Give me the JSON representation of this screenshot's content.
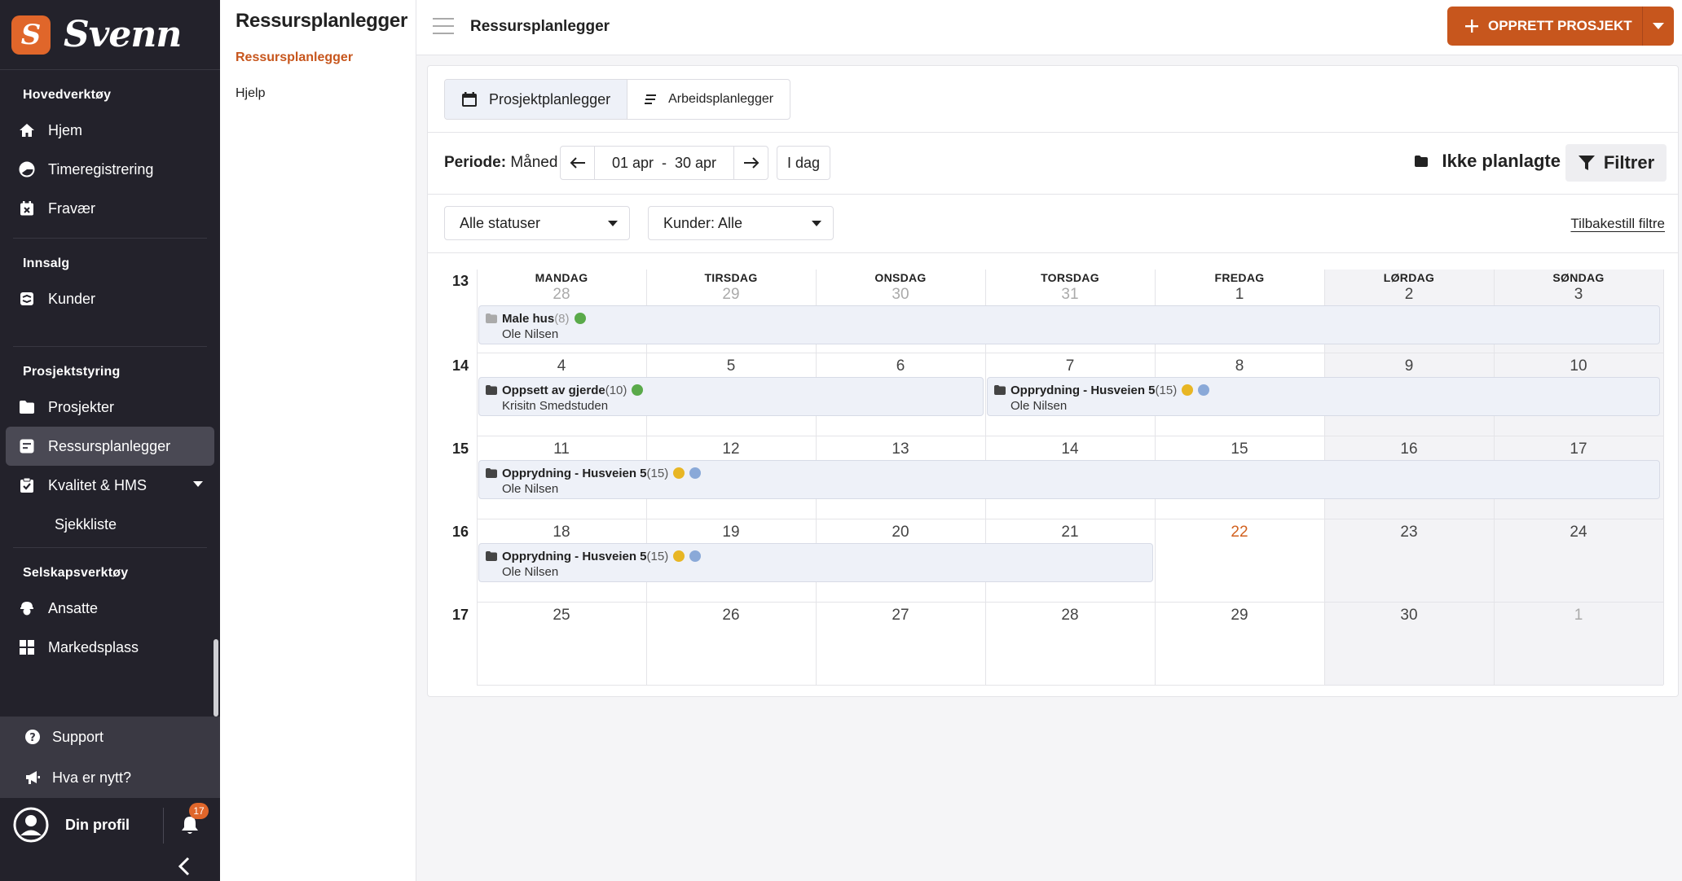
{
  "logo": {
    "badge": "S",
    "name": "Svenn"
  },
  "sidebar": {
    "sections": [
      {
        "heading": "Hovedverktøy",
        "items": [
          {
            "label": "Hjem",
            "icon": "home-icon"
          },
          {
            "label": "Timeregistrering",
            "icon": "clock-icon"
          },
          {
            "label": "Fravær",
            "icon": "calendar-x-icon"
          }
        ]
      },
      {
        "heading": "Innsalg",
        "items": [
          {
            "label": "Kunder",
            "icon": "customers-icon"
          }
        ]
      },
      {
        "heading": "Prosjektstyring",
        "items": [
          {
            "label": "Prosjekter",
            "icon": "folder-icon"
          },
          {
            "label": "Ressursplanlegger",
            "icon": "planner-icon",
            "active": true
          },
          {
            "label": "Kvalitet & HMS",
            "icon": "quality-icon",
            "expandable": true
          },
          {
            "label": "Sjekkliste",
            "sub": true
          }
        ]
      },
      {
        "heading": "Selskapsverktøy",
        "items": [
          {
            "label": "Ansatte",
            "icon": "employees-icon"
          },
          {
            "label": "Markedsplass",
            "icon": "marketplace-icon"
          }
        ]
      }
    ],
    "bottom": {
      "support": "Support",
      "news": "Hva er nytt?",
      "profile": "Din profil",
      "notifications": "17"
    }
  },
  "subpanel": {
    "title": "Ressursplanlegger",
    "links": [
      "Ressursplanlegger",
      "Hjelp"
    ]
  },
  "topbar": {
    "title": "Ressursplanlegger",
    "create_button": "OPPRETT PROSJEKT"
  },
  "tabs": [
    {
      "label": "Prosjektplanlegger",
      "active": true
    },
    {
      "label": "Arbeidsplanlegger",
      "active": false
    }
  ],
  "period": {
    "label": "Periode:",
    "value": "Måned",
    "range_start": "01 apr",
    "range_sep": "-",
    "range_end": "30 apr",
    "today": "I dag",
    "unplanned": "Ikke planlagte",
    "filter": "Filtrer"
  },
  "filters": {
    "status": "Alle statuser",
    "customers": "Kunder: Alle",
    "reset": "Tilbakestill filtre"
  },
  "colors": {
    "brand": "#c7561d",
    "green": "#5aaa4a",
    "yellow": "#e8b624",
    "blue": "#8aa9d8",
    "today": "#d2611f"
  },
  "calendar": {
    "weekdays": [
      "MANDAG",
      "TIRSDAG",
      "ONSDAG",
      "TORSDAG",
      "FREDAG",
      "LØRDAG",
      "SØNDAG"
    ],
    "weeks": [
      {
        "num": "13",
        "days": [
          {
            "d": "28",
            "muted": true
          },
          {
            "d": "29",
            "muted": true
          },
          {
            "d": "30",
            "muted": true
          },
          {
            "d": "31",
            "muted": true
          },
          {
            "d": "1"
          },
          {
            "d": "2"
          },
          {
            "d": "3"
          }
        ]
      },
      {
        "num": "14",
        "days": [
          {
            "d": "4"
          },
          {
            "d": "5"
          },
          {
            "d": "6"
          },
          {
            "d": "7"
          },
          {
            "d": "8"
          },
          {
            "d": "9"
          },
          {
            "d": "10"
          }
        ]
      },
      {
        "num": "15",
        "days": [
          {
            "d": "11"
          },
          {
            "d": "12"
          },
          {
            "d": "13"
          },
          {
            "d": "14"
          },
          {
            "d": "15"
          },
          {
            "d": "16"
          },
          {
            "d": "17"
          }
        ]
      },
      {
        "num": "16",
        "days": [
          {
            "d": "18"
          },
          {
            "d": "19"
          },
          {
            "d": "20"
          },
          {
            "d": "21"
          },
          {
            "d": "22",
            "today": true
          },
          {
            "d": "23"
          },
          {
            "d": "24"
          }
        ]
      },
      {
        "num": "17",
        "days": [
          {
            "d": "25"
          },
          {
            "d": "26"
          },
          {
            "d": "27"
          },
          {
            "d": "28"
          },
          {
            "d": "29"
          },
          {
            "d": "30"
          },
          {
            "d": "1",
            "muted": true
          }
        ]
      }
    ],
    "events": [
      {
        "week": 0,
        "start": 0,
        "span": 7,
        "title": "Male hus",
        "count": "(8)",
        "person": "Ole Nilsen",
        "dots": [
          "green"
        ],
        "light": true
      },
      {
        "week": 1,
        "start": 0,
        "span": 3,
        "title": "Oppsett av gjerde",
        "count": "(10)",
        "person": "Krisitn Smedstuden",
        "dots": [
          "green"
        ]
      },
      {
        "week": 1,
        "start": 3,
        "span": 4,
        "title": "Opprydning - Husveien 5",
        "count": "(15)",
        "person": "Ole Nilsen",
        "dots": [
          "yellow",
          "blue"
        ]
      },
      {
        "week": 2,
        "start": 0,
        "span": 7,
        "title": "Opprydning - Husveien 5",
        "count": "(15)",
        "person": "Ole Nilsen",
        "dots": [
          "yellow",
          "blue"
        ]
      },
      {
        "week": 3,
        "start": 0,
        "span": 4,
        "title": "Opprydning - Husveien 5",
        "count": "(15)",
        "person": "Ole Nilsen",
        "dots": [
          "yellow",
          "blue"
        ]
      }
    ]
  }
}
